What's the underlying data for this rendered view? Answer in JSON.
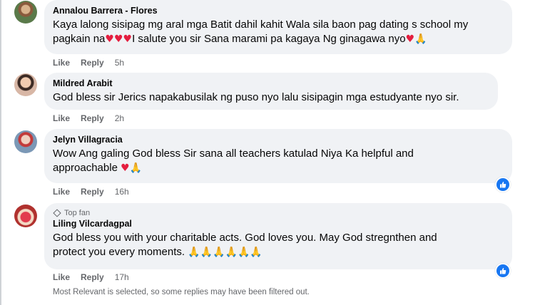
{
  "comments": [
    {
      "author": "Annalou Barrera - Flores",
      "text_line1": "Kaya lalong sisipag mg aral mga Batit dahil kahit Wala sila baon pag dating s school my",
      "text_line2": "pagkain na",
      "text_line2b": "I salute you sir Sana marami pa kagaya Ng ginagawa nyo",
      "like": "Like",
      "reply": "Reply",
      "time": "5h",
      "avatar_icon": "user-photo"
    },
    {
      "author": "Mildred Arabit",
      "text": "God bless sir Jerics napakabusilak ng puso nyo lalu sisipagin mga estudyante nyo sir.",
      "like": "Like",
      "reply": "Reply",
      "time": "2h",
      "avatar_icon": "user-photo"
    },
    {
      "author": "Jelyn Villagracia",
      "text_line1": "Wow Ang galing God bless Sir sana all teachers katulad Niya Ka helpful and",
      "text_line2": "approachable",
      "like": "Like",
      "reply": "Reply",
      "time": "16h",
      "reaction_icon": "like-icon",
      "avatar_icon": "user-photo"
    },
    {
      "badge": "Top fan",
      "author": "Liling Vilcardagpal",
      "text_line1": "God bless you with your charitable acts. God loves you. May God stregnthen and",
      "text_line2": "protect you every moments.",
      "like": "Like",
      "reply": "Reply",
      "time": "17h",
      "reaction_icon": "like-icon",
      "avatar_icon": "user-photo"
    }
  ],
  "filter_note": "Most Relevant is selected, so some replies may have been filtered out.",
  "colors": {
    "bubble": "#f0f2f5",
    "meta_text": "#65676b",
    "like_blue": "#1877f2",
    "heart": "#e41e3f"
  }
}
